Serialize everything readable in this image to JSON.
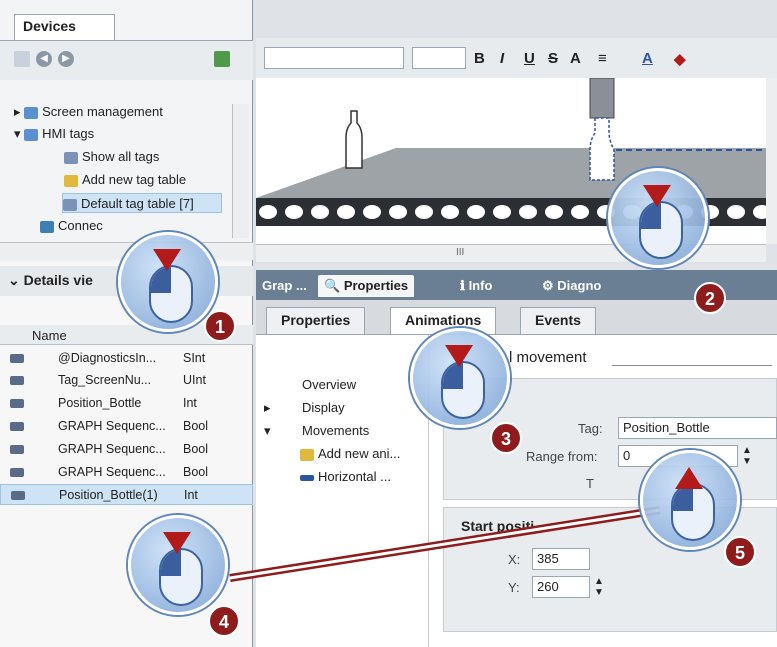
{
  "devices": {
    "tab_label": "Devices",
    "tree": [
      {
        "label": "Screen management"
      },
      {
        "label": "HMI tags"
      },
      {
        "label": "Show all tags"
      },
      {
        "label": "Add new tag table"
      },
      {
        "label": "Default tag table [7]"
      },
      {
        "label": "Connec"
      }
    ]
  },
  "details": {
    "title": "Details vie",
    "column_name": "Name",
    "rows": [
      {
        "name": "@DiagnosticsIn...",
        "type": "SInt"
      },
      {
        "name": "Tag_ScreenNu...",
        "type": "UInt"
      },
      {
        "name": "Position_Bottle",
        "type": "Int"
      },
      {
        "name": "GRAPH Sequenc...",
        "type": "Bool"
      },
      {
        "name": "GRAPH Sequenc...",
        "type": "Bool"
      },
      {
        "name": "GRAPH Sequenc...",
        "type": "Bool"
      },
      {
        "name": "Position_Bottle(1)",
        "type": "Int"
      }
    ]
  },
  "editor": {
    "format_buttons": [
      "B",
      "I",
      "U",
      "S",
      "A"
    ],
    "hscroll_thumb": "III"
  },
  "inspector": {
    "tabs": [
      "Grap ...",
      "Properties",
      "Info",
      "Diagno"
    ],
    "subtabs": [
      "Properties",
      "Animations",
      "Events"
    ],
    "section_title": "l movement",
    "nav": [
      "Overview",
      "Display",
      "Movements",
      "Add new ani...",
      "Horizontal ..."
    ],
    "tag_label": "Tag:",
    "tag_value": "Position_Bottle",
    "range_from_label": "Range from:",
    "range_from_value": "0",
    "to_label": "T",
    "start_title": "Start positi",
    "x_label": "X:",
    "x_value": "385",
    "y_label": "Y:",
    "y_value": "260"
  },
  "callouts": [
    "1",
    "2",
    "3",
    "4",
    "5"
  ],
  "colors": {
    "accent": "#8e1c1c",
    "selection": "#cfe3f7",
    "inspector_bar": "#6a7f94"
  }
}
